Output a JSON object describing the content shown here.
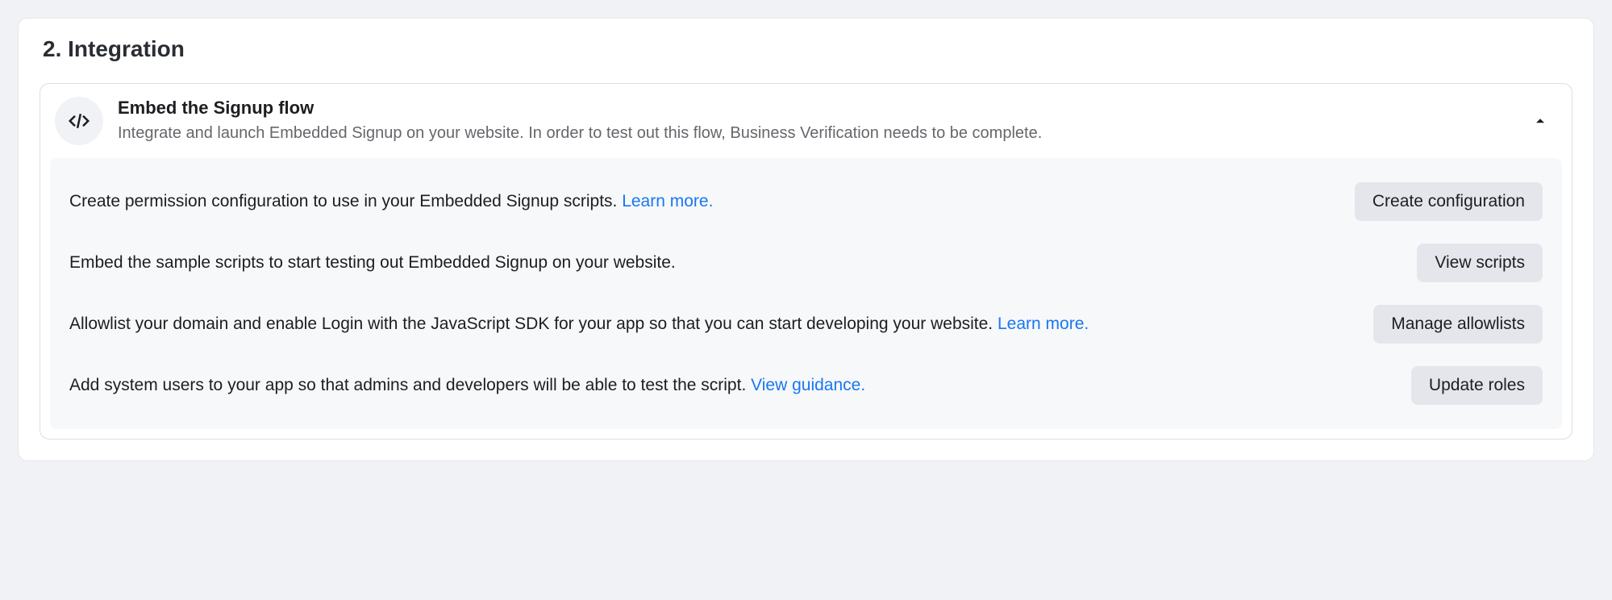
{
  "section": {
    "number": "2.",
    "title": "Integration"
  },
  "panel": {
    "icon": "code-icon",
    "title": "Embed the Signup flow",
    "description": "Integrate and launch Embedded Signup on your website. In order to test out this flow, Business Verification needs to be complete.",
    "expanded": true
  },
  "rows": [
    {
      "text": "Create permission configuration to use in your Embedded Signup scripts. ",
      "link": "Learn more.",
      "button": "Create configuration"
    },
    {
      "text": "Embed the sample scripts to start testing out Embedded Signup on your website.",
      "link": "",
      "button": "View scripts"
    },
    {
      "text": "Allowlist your domain and enable Login with the JavaScript SDK for your app so that you can start developing your website. ",
      "link": "Learn more.",
      "button": "Manage allowlists"
    },
    {
      "text": "Add system users to your app so that admins and developers will be able to test the script. ",
      "link": "View guidance.",
      "button": "Update roles"
    }
  ]
}
